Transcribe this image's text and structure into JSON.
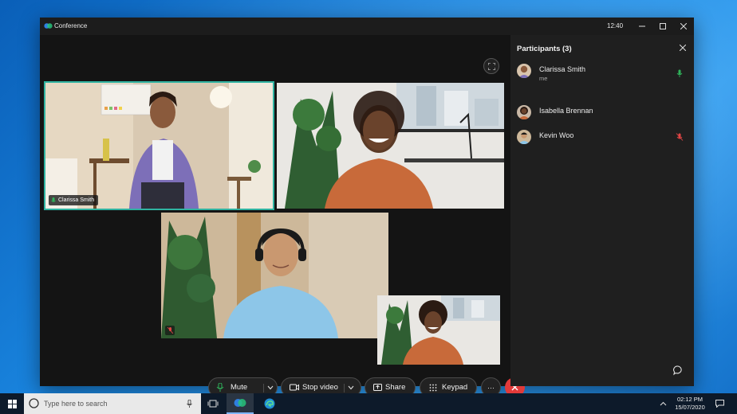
{
  "window": {
    "title": "Conference",
    "time": "12:40"
  },
  "stage": {
    "tiles": [
      {
        "name": "Clarissa Smith",
        "active": true
      }
    ]
  },
  "participants": {
    "header": "Participants (3)",
    "list": [
      {
        "name": "Clarissa Smith",
        "sub": "me",
        "status": "mic-on-icon",
        "status_color": "#2fb35a"
      },
      {
        "name": "Isabella Brennan",
        "sub": "",
        "status": "",
        "status_color": ""
      },
      {
        "name": "Kevin Woo",
        "sub": "",
        "status": "mic-muted-icon",
        "status_color": "#e04545"
      }
    ]
  },
  "toolbar": {
    "mute_label": "Mute",
    "video_label": "Stop video",
    "share_label": "Share",
    "keypad_label": "Keypad",
    "more_label": "···",
    "end_call_color": "#e23a3a"
  },
  "taskbar": {
    "search_placeholder": "Type here to search",
    "time": "02:12 PM",
    "date": "15/07/2020"
  },
  "colors": {
    "accent": "#2fb3a1",
    "desktop_blue": "#1a86e0",
    "window_bg": "#1c1c1c"
  }
}
